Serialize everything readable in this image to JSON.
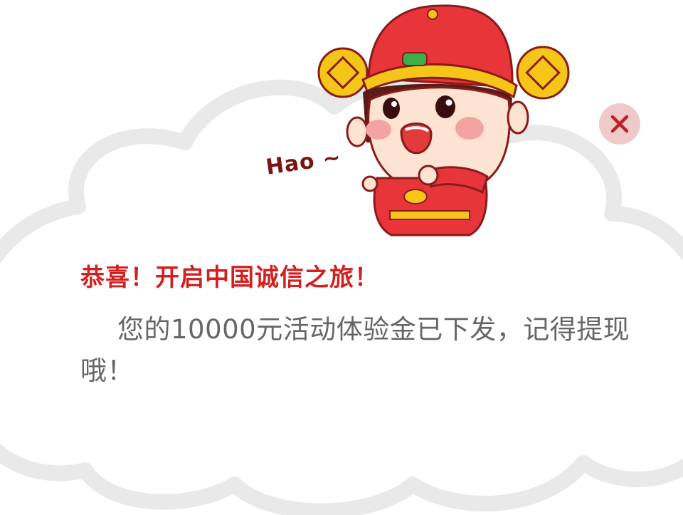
{
  "dialog": {
    "mascot_speech": "Hao ~",
    "headline": "恭喜！开启中国诚信之旅！",
    "message": "您的10000元活动体验金已下发，记得提现哦！"
  },
  "close_button": {
    "icon": "close-icon"
  },
  "colors": {
    "headline_red": "#d41f1f",
    "message_gray": "#666666",
    "close_bg": "#f0c9c9",
    "close_x": "#c0202a",
    "cloud_outline": "#e9e9e9",
    "mascot_red": "#e8353a",
    "mascot_gold": "#f5c518"
  }
}
